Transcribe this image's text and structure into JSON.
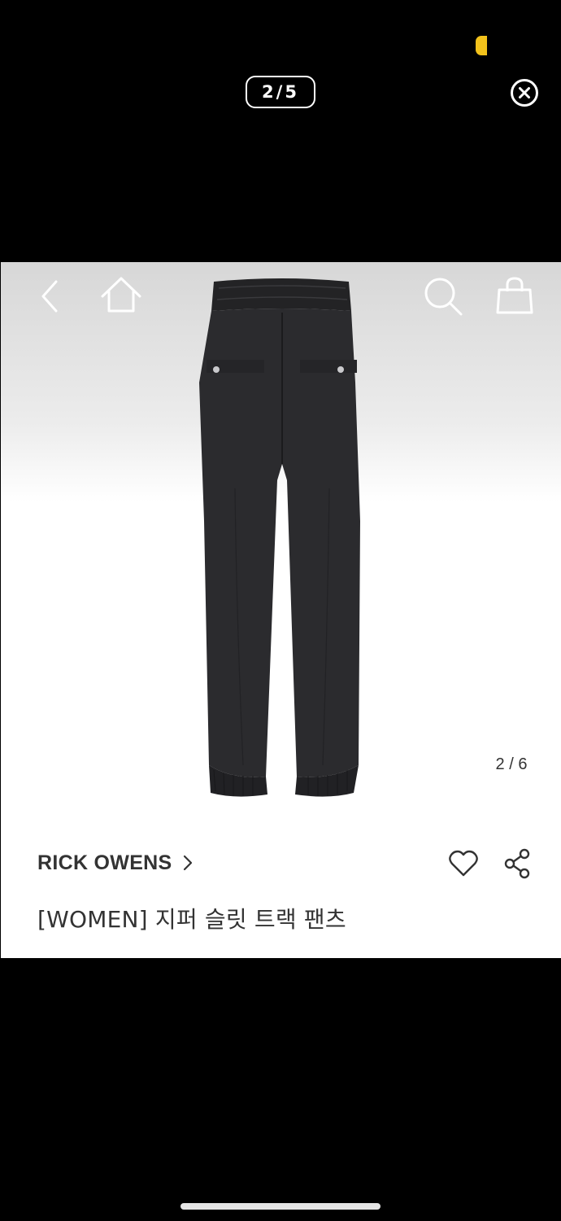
{
  "viewer": {
    "counter": "2/5"
  },
  "product": {
    "image_counter": "2 / 6",
    "brand": "RICK OWENS",
    "title": "[WOMEN] 지퍼 슬릿 트랙 팬츠"
  },
  "colors": {
    "status_accent": "#f2c21b",
    "text": "#333333",
    "background": "#000000"
  },
  "icons": {
    "close": "close-circle-icon",
    "back": "chevron-left-icon",
    "home": "home-icon",
    "search": "search-icon",
    "bag": "shopping-bag-icon",
    "brand_chevron": "chevron-right-icon",
    "wish": "heart-icon",
    "share": "share-icon"
  }
}
